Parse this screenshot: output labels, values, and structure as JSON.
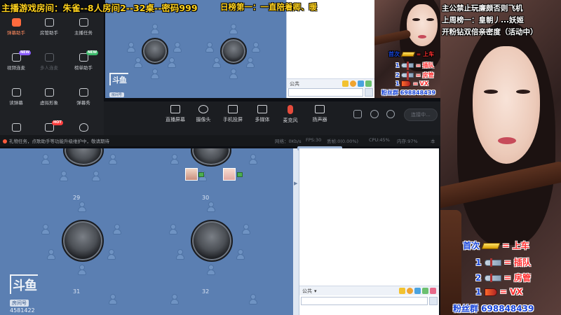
{
  "overlay": {
    "room_caption": "主播游戏房间：朱雀--8人房间2--32桌--密码999",
    "daily_rank_caption": "日榜第一：一直陪着卿、暖"
  },
  "tools": [
    {
      "label": "弹幕助手",
      "icon": "danmu-helper-icon",
      "active": true
    },
    {
      "label": "房管助手",
      "icon": "room-admin-icon"
    },
    {
      "label": "主播任务",
      "icon": "streamer-task-icon"
    },
    {
      "label": "视频连麦",
      "icon": "video-mic-icon",
      "badge": "NEW"
    },
    {
      "label": "多人连麦",
      "icon": "multi-mic-icon",
      "disabled": true
    },
    {
      "label": "榜单助手",
      "icon": "rank-helper-icon",
      "badge": "NEW"
    },
    {
      "label": "读弹幕",
      "icon": "read-danmu-icon"
    },
    {
      "label": "虚拟形象",
      "icon": "avatar-figure-icon"
    },
    {
      "label": "弹幕秀",
      "icon": "danmu-show-icon"
    },
    {
      "label": "",
      "icon": "more-tool-icon"
    },
    {
      "label": "",
      "icon": "hot-tool-icon",
      "badge": "HOT"
    },
    {
      "label": "",
      "icon": "fire-tool-icon"
    }
  ],
  "controls": [
    {
      "label": "直播屏幕",
      "icon": "screen-share-icon"
    },
    {
      "label": "摄像头",
      "icon": "camera-icon"
    },
    {
      "label": "手机投屏",
      "icon": "phone-cast-icon"
    },
    {
      "label": "多媒体",
      "icon": "media-icon"
    },
    {
      "label": "麦克风",
      "icon": "microphone-icon"
    },
    {
      "label": "扬声器",
      "icon": "speaker-icon"
    }
  ],
  "connect_button": "连接中...",
  "status": {
    "notice": "礼物任务，点歌助手等功能升级维护中，敬请期待",
    "net": "网络：0Kb/s",
    "fps": "FPS:30",
    "drop": "丢帧:0(0.00%)",
    "cpu": "CPU:45%",
    "mem": "内存:97%",
    "tail": "本"
  },
  "game": {
    "table_numbers": [
      "29",
      "30",
      "31",
      "32"
    ],
    "watermark_brand": "斗鱼",
    "watermark_tag": "房间号",
    "room_id": "4581422"
  },
  "chat": {
    "channel": "公共",
    "top_channel": "公共"
  },
  "cam_small": {
    "lines": [
      {
        "text": "主公禁止玩廉颇否则飞机"
      },
      {
        "text": "上周榜一：皇朝丿...妖姬"
      },
      {
        "text": "开粉钻双倍亲密度（活动中）"
      }
    ],
    "rank1_label": "首次",
    "rank1_value": "= 上车",
    "rank2_value": "= 插队",
    "rank3_value": "= 房管",
    "rank4_value": "= VX",
    "rank_count": "1",
    "rank_count2": "2",
    "fans_group": "粉丝群 698848439"
  },
  "cam_big": {
    "rank1_label": "首次",
    "rank1_value": "= 上车",
    "rank2_count": "1",
    "rank2_value": "= 插队",
    "rank3_count": "2",
    "rank3_value": "= 房管",
    "rank4_count": "1",
    "rank4_value": "= VX",
    "fans_group": "粉丝群 698848439"
  },
  "colors": {
    "stage_blue": "#5b7fb2",
    "caption_yellow": "#ffd21e",
    "accent_orange": "#ff6a3d",
    "rank_blue": "#1744d8",
    "rank_red": "#ff3030"
  }
}
